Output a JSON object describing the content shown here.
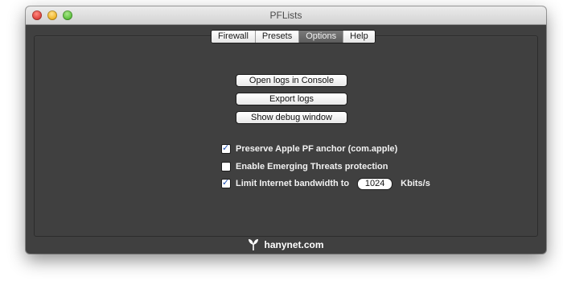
{
  "window": {
    "title": "PFLists"
  },
  "tabs": [
    {
      "label": "Firewall",
      "active": false
    },
    {
      "label": "Presets",
      "active": false
    },
    {
      "label": "Options",
      "active": true
    },
    {
      "label": "Help",
      "active": false
    }
  ],
  "buttons": {
    "open_logs": "Open logs in Console",
    "export_logs": "Export logs",
    "show_debug": "Show debug window"
  },
  "options": {
    "preserve_anchor": {
      "label": "Preserve Apple PF anchor (com.apple)",
      "checked": true
    },
    "emerging_threats": {
      "label": "Enable Emerging Threats protection",
      "checked": false
    },
    "limit_bandwidth": {
      "label": "Limit Internet bandwidth to",
      "checked": true,
      "value": "1024",
      "unit": "Kbits/s"
    }
  },
  "footer": {
    "brand": "hanynet.com",
    "logo_icon": "hanynet-logo-icon"
  }
}
